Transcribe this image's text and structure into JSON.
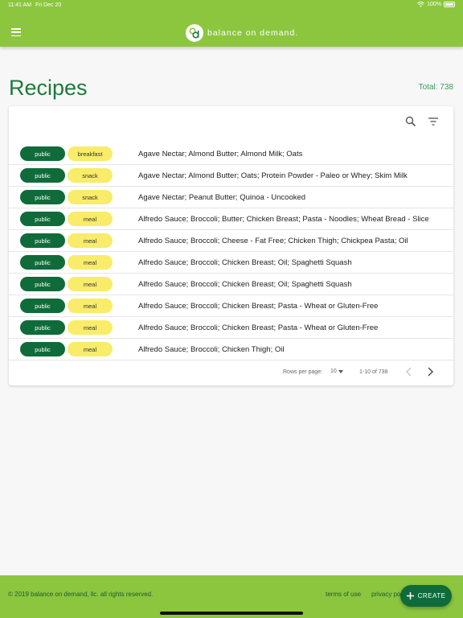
{
  "status": {
    "time": "11:41 AM",
    "date": "Fri Dec 20",
    "battery": "100%"
  },
  "brand": {
    "name": "balance on demand."
  },
  "page": {
    "title": "Recipes",
    "total": "Total: 738"
  },
  "table": {
    "rows": [
      {
        "visibility": "public",
        "category": "breakfast",
        "ingredients": "Agave Nectar; Almond Butter; Almond Milk; Oats"
      },
      {
        "visibility": "public",
        "category": "snack",
        "ingredients": "Agave Nectar; Almond Butter; Oats; Protein Powder - Paleo or Whey; Skim Milk"
      },
      {
        "visibility": "public",
        "category": "snack",
        "ingredients": "Agave Nectar; Peanut Butter; Quinoa - Uncooked"
      },
      {
        "visibility": "public",
        "category": "meal",
        "ingredients": "Alfredo Sauce; Broccoli; Butter; Chicken Breast; Pasta - Noodles; Wheat Bread - Slice"
      },
      {
        "visibility": "public",
        "category": "meal",
        "ingredients": "Alfredo Sauce; Broccoli; Cheese - Fat Free; Chicken Thigh; Chickpea Pasta; Oil"
      },
      {
        "visibility": "public",
        "category": "meal",
        "ingredients": "Alfredo Sauce; Broccoli; Chicken Breast; Oil; Spaghetti Squash"
      },
      {
        "visibility": "public",
        "category": "meal",
        "ingredients": "Alfredo Sauce; Broccoli; Chicken Breast; Oil; Spaghetti Squash"
      },
      {
        "visibility": "public",
        "category": "meal",
        "ingredients": "Alfredo Sauce; Broccoli; Chicken Breast; Pasta - Wheat or Gluten-Free"
      },
      {
        "visibility": "public",
        "category": "meal",
        "ingredients": "Alfredo Sauce; Broccoli; Chicken Breast; Pasta - Wheat or Gluten-Free"
      },
      {
        "visibility": "public",
        "category": "meal",
        "ingredients": "Alfredo Sauce; Broccoli; Chicken Thigh; Oil"
      }
    ],
    "pagination": {
      "rows_per_page_label": "Rows per page:",
      "rows_per_page": "10",
      "range": "1-10 of 738"
    }
  },
  "footer": {
    "copyright": "© 2019 balance on demand, llc. all rights reserved.",
    "terms": "terms of use",
    "privacy": "privacy po"
  },
  "fab": {
    "label": "CREATE"
  },
  "colors": {
    "brand_green": "#8cc63f",
    "dark_green": "#106b3a",
    "chip_yellow": "#f8ec6a",
    "title_green": "#1e7a3c"
  },
  "icons": {
    "menu": "menu-icon",
    "search": "search-icon",
    "filter": "filter-icon",
    "prev": "chevron-left-icon",
    "next": "chevron-right-icon",
    "add": "plus-icon"
  }
}
